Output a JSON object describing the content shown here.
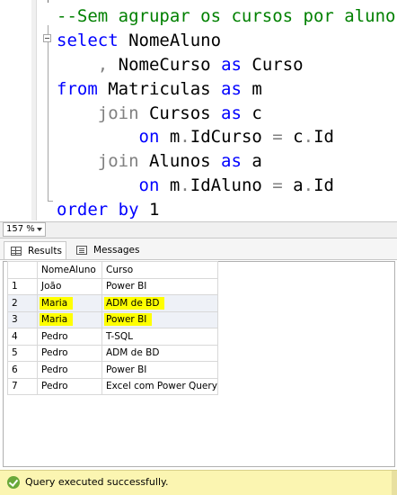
{
  "editor": {
    "lines": [
      [
        {
          "t": "--Sem agrupar os cursos por aluno",
          "c": "cm"
        }
      ],
      [
        {
          "t": "select",
          "c": "kw"
        },
        {
          "t": " NomeAluno",
          "c": ""
        }
      ],
      [
        {
          "t": "    ",
          "c": ""
        },
        {
          "t": ",",
          "c": "op"
        },
        {
          "t": " NomeCurso ",
          "c": ""
        },
        {
          "t": "as",
          "c": "kw"
        },
        {
          "t": " Curso",
          "c": ""
        }
      ],
      [
        {
          "t": "from",
          "c": "kw"
        },
        {
          "t": " Matriculas ",
          "c": ""
        },
        {
          "t": "as",
          "c": "kw"
        },
        {
          "t": " m",
          "c": ""
        }
      ],
      [
        {
          "t": "    ",
          "c": ""
        },
        {
          "t": "join",
          "c": "op"
        },
        {
          "t": " Cursos ",
          "c": ""
        },
        {
          "t": "as",
          "c": "kw"
        },
        {
          "t": " c",
          "c": ""
        }
      ],
      [
        {
          "t": "        ",
          "c": ""
        },
        {
          "t": "on",
          "c": "kw"
        },
        {
          "t": " m",
          "c": ""
        },
        {
          "t": ".",
          "c": "op"
        },
        {
          "t": "IdCurso ",
          "c": ""
        },
        {
          "t": "=",
          "c": "op"
        },
        {
          "t": " c",
          "c": ""
        },
        {
          "t": ".",
          "c": "op"
        },
        {
          "t": "Id",
          "c": ""
        }
      ],
      [
        {
          "t": "    ",
          "c": ""
        },
        {
          "t": "join",
          "c": "op"
        },
        {
          "t": " Alunos ",
          "c": ""
        },
        {
          "t": "as",
          "c": "kw"
        },
        {
          "t": " a",
          "c": ""
        }
      ],
      [
        {
          "t": "        ",
          "c": ""
        },
        {
          "t": "on",
          "c": "kw"
        },
        {
          "t": " m",
          "c": ""
        },
        {
          "t": ".",
          "c": "op"
        },
        {
          "t": "IdAluno ",
          "c": ""
        },
        {
          "t": "=",
          "c": "op"
        },
        {
          "t": " a",
          "c": ""
        },
        {
          "t": ".",
          "c": "op"
        },
        {
          "t": "Id",
          "c": ""
        }
      ],
      [
        {
          "t": "order",
          "c": "kw"
        },
        {
          "t": " ",
          "c": ""
        },
        {
          "t": "by",
          "c": "kw"
        },
        {
          "t": " 1",
          "c": ""
        }
      ]
    ]
  },
  "zoom": {
    "value": "157 %"
  },
  "tabs": {
    "results_label": "Results",
    "messages_label": "Messages"
  },
  "results": {
    "columns": [
      "NomeAluno",
      "Curso"
    ],
    "rows": [
      {
        "n": "1",
        "aluno": "João",
        "curso": "Power BI",
        "sel": false,
        "hl_aluno": false,
        "hl_curso": false
      },
      {
        "n": "2",
        "aluno": "Maria",
        "curso": "ADM de BD",
        "sel": true,
        "hl_aluno": true,
        "hl_curso": true
      },
      {
        "n": "3",
        "aluno": "Maria",
        "curso": "Power BI",
        "sel": true,
        "hl_aluno": true,
        "hl_curso": true
      },
      {
        "n": "4",
        "aluno": "Pedro",
        "curso": "T-SQL",
        "sel": false,
        "hl_aluno": false,
        "hl_curso": false
      },
      {
        "n": "5",
        "aluno": "Pedro",
        "curso": "ADM de BD",
        "sel": false,
        "hl_aluno": false,
        "hl_curso": false
      },
      {
        "n": "6",
        "aluno": "Pedro",
        "curso": "Power BI",
        "sel": false,
        "hl_aluno": false,
        "hl_curso": false
      },
      {
        "n": "7",
        "aluno": "Pedro",
        "curso": "Excel com Power Query",
        "sel": false,
        "hl_aluno": false,
        "hl_curso": false
      }
    ]
  },
  "status": {
    "text": "Query executed successfully.",
    "icon": "check-circle-icon",
    "color": "#fbf5b1"
  },
  "colors": {
    "keyword": "#0000ff",
    "comment": "#008000",
    "operator": "#808080",
    "highlight": "#ffff00"
  }
}
